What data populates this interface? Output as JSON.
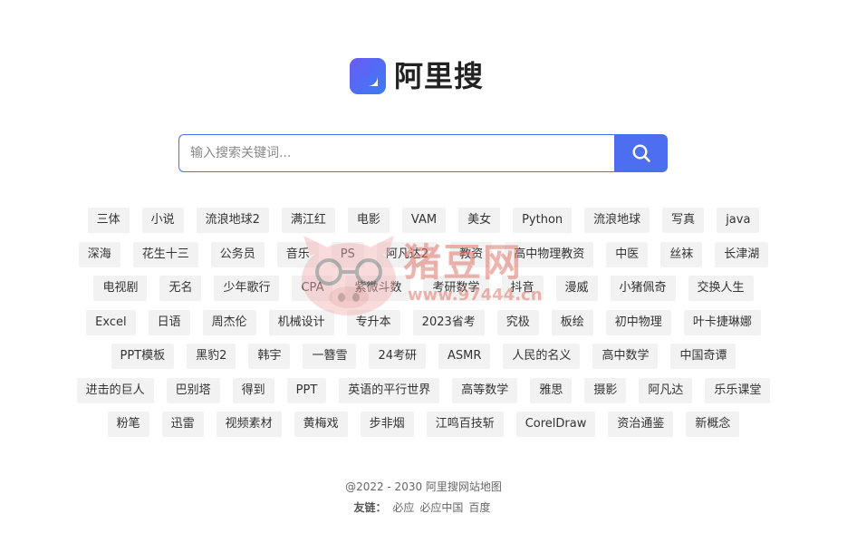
{
  "brand": {
    "name": "阿里搜",
    "accent": "#4e6ef2"
  },
  "search": {
    "placeholder": "输入搜索关键词...",
    "button_icon": "search-icon"
  },
  "tags": [
    [
      "三体",
      "小说",
      "流浪地球2",
      "满江红",
      "电影",
      "VAM",
      "美女",
      "Python",
      "流浪地球",
      "写真",
      "java"
    ],
    [
      "深海",
      "花生十三",
      "公务员",
      "音乐",
      "PS",
      "阿凡达2",
      "教资",
      "高中物理教资",
      "中医",
      "丝袜",
      "长津湖"
    ],
    [
      "电视剧",
      "无名",
      "少年歌行",
      "CPA",
      "紫微斗数",
      "考研数学",
      "抖音",
      "漫威",
      "小猪佩奇",
      "交换人生"
    ],
    [
      "Excel",
      "日语",
      "周杰伦",
      "机械设计",
      "专升本",
      "2023省考",
      "究极",
      "板绘",
      "初中物理",
      "叶卡捷琳娜"
    ],
    [
      "PPT模板",
      "黑豹2",
      "韩宇",
      "一簪雪",
      "24考研",
      "ASMR",
      "人民的名义",
      "高中数学",
      "中国奇谭"
    ],
    [
      "进击的巨人",
      "巴别塔",
      "得到",
      "PPT",
      "英语的平行世界",
      "高等数学",
      "雅思",
      "摄影",
      "阿凡达",
      "乐乐课堂"
    ],
    [
      "粉笔",
      "迅雷",
      "视频素材",
      "黄梅戏",
      "步非烟",
      "江鸣百技斩",
      "CorelDraw",
      "资治通鉴",
      "新概念"
    ]
  ],
  "watermark": {
    "text": "猪豆网",
    "url": "www.97444.cn"
  },
  "footer": {
    "copyright": "@2022 - 2030 阿里搜网站地图",
    "links_label": "友链：",
    "links": [
      "必应",
      "必应中国",
      "百度"
    ]
  }
}
